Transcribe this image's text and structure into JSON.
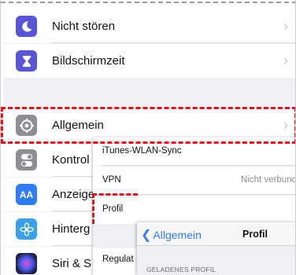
{
  "settings": {
    "rows": [
      {
        "label": "Nicht stören",
        "icon": "moon-icon",
        "color": "#5856d6"
      },
      {
        "label": "Bildschirmzeit",
        "icon": "hourglass-icon",
        "color": "#5856d6"
      },
      {
        "label": "Allgemein",
        "icon": "gear-icon",
        "color": "#8e8e93"
      },
      {
        "label": "Kontrol",
        "icon": "toggle-icon",
        "color": "#8e8e93"
      },
      {
        "label": "Anzeige",
        "icon": "text-size-icon",
        "color": "#2f7cf6"
      },
      {
        "label": "Hinterg",
        "icon": "flower-icon",
        "color": "#3aa0e8"
      },
      {
        "label": "Siri & S",
        "icon": "siri-icon",
        "color": "#1c1c3c"
      }
    ]
  },
  "general": {
    "rows": [
      {
        "label": "iTunes-WLAN-Sync",
        "value": ""
      },
      {
        "label": "VPN",
        "value": "Nicht verbund"
      },
      {
        "label": "Profil",
        "value": ""
      }
    ],
    "regulatory_label": "Regulat"
  },
  "profile": {
    "back_label": "Allgemein",
    "title": "Profil",
    "section_header": "GELADENES PROFIL"
  },
  "colors": {
    "highlight": "#e0141b",
    "accent": "#2f7cf6"
  }
}
